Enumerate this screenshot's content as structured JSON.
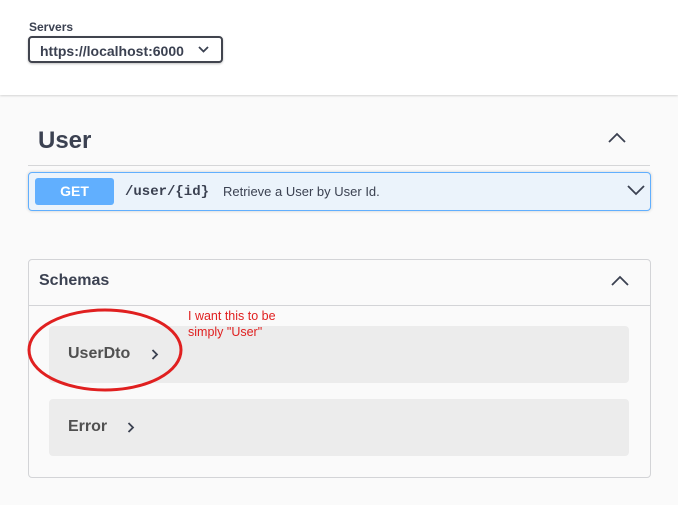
{
  "servers": {
    "label": "Servers",
    "selected": "https://localhost:6000"
  },
  "tag": {
    "title": "User"
  },
  "operation": {
    "method": "GET",
    "path": "/user/{id}",
    "summary": "Retrieve a User by User Id.",
    "method_color": "#61affe"
  },
  "schemas": {
    "title": "Schemas",
    "items": [
      {
        "name": "UserDto"
      },
      {
        "name": "Error"
      }
    ]
  },
  "annotation": {
    "text": "I want this to be simply \"User\"",
    "color": "#e02020"
  },
  "icons": [
    "chevron-down-icon",
    "chevron-up-icon",
    "chevron-right-icon"
  ]
}
